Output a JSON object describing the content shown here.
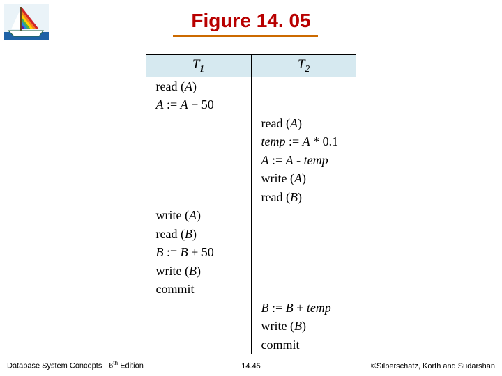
{
  "title": "Figure 14. 05",
  "columns": {
    "t1": "T",
    "t1_sub": "1",
    "t2": "T",
    "t2_sub": "2"
  },
  "schedule": [
    {
      "t1": "read (A)",
      "t2": ""
    },
    {
      "t1": "A := A − 50",
      "t2": ""
    },
    {
      "t1": "",
      "t2": "read (A)"
    },
    {
      "t1": "",
      "t2": "temp := A * 0.1"
    },
    {
      "t1": "",
      "t2": "A := A - temp"
    },
    {
      "t1": "",
      "t2": "write (A)"
    },
    {
      "t1": "",
      "t2": "read (B)"
    },
    {
      "t1": "write (A)",
      "t2": ""
    },
    {
      "t1": "read (B)",
      "t2": ""
    },
    {
      "t1": "B := B + 50",
      "t2": ""
    },
    {
      "t1": "write (B)",
      "t2": ""
    },
    {
      "t1": "commit",
      "t2": ""
    },
    {
      "t1": "",
      "t2": "B := B + temp"
    },
    {
      "t1": "",
      "t2": "write (B)"
    },
    {
      "t1": "",
      "t2": "commit"
    }
  ],
  "footer": {
    "left_pre": "Database System Concepts - 6",
    "left_sup": "th",
    "left_post": " Edition",
    "center": "14.45",
    "right": "©Silberschatz, Korth and Sudarshan"
  },
  "logo": {
    "name": "sailboat-rainbow-logo"
  }
}
